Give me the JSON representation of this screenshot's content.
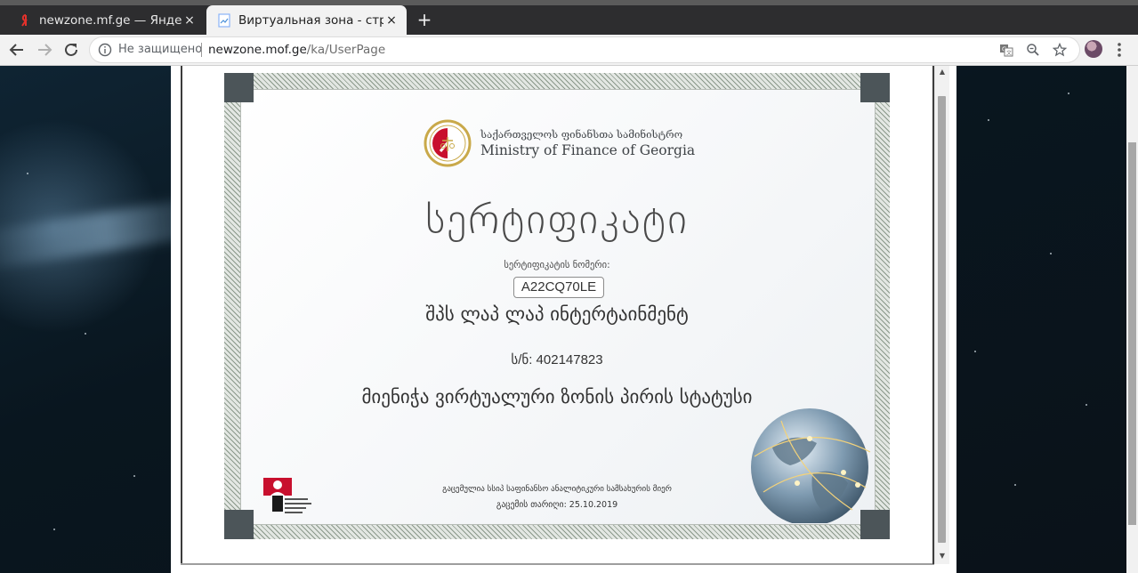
{
  "tabs": [
    {
      "title": "newzone.mf.ge — Яндекс",
      "icon": "yandex-icon",
      "active": false,
      "close": "×"
    },
    {
      "title": "Виртуальная зона - страница",
      "icon": "page-icon",
      "active": true,
      "close": "×"
    }
  ],
  "new_tab_label": "+",
  "omnibox": {
    "security_text": "Не защищено",
    "url_host": "newzone.mof.ge",
    "url_path": "/ka/UserPage"
  },
  "certificate": {
    "ministry_ka": "საქართველოს ფინანსთა სამინისტრო",
    "ministry_en": "Ministry of Finance of Georgia",
    "title": "სერტიფიკატი",
    "number_label": "სერტიფიკატის ნომერი:",
    "number": "A22CQ70LE",
    "company": "შპს ლაპ ლაპ ინტერტაინმენტ",
    "tax_id": "ს/ნ: 402147823",
    "status_text": "მიენიჭა ვირტუალური ზონის პირის სტატუსი",
    "issued_by": "გაცემულია სსიპ საფინანსო ანალიტიკური სამსახურის მიერ",
    "issued_date": "გაცემის თარიღი: 25.10.2019"
  },
  "colors": {
    "tab_bar": "#2d2d2f",
    "toolbar": "#f2f2f2",
    "corner": "#4c5559",
    "logo_red": "#c8102e"
  }
}
